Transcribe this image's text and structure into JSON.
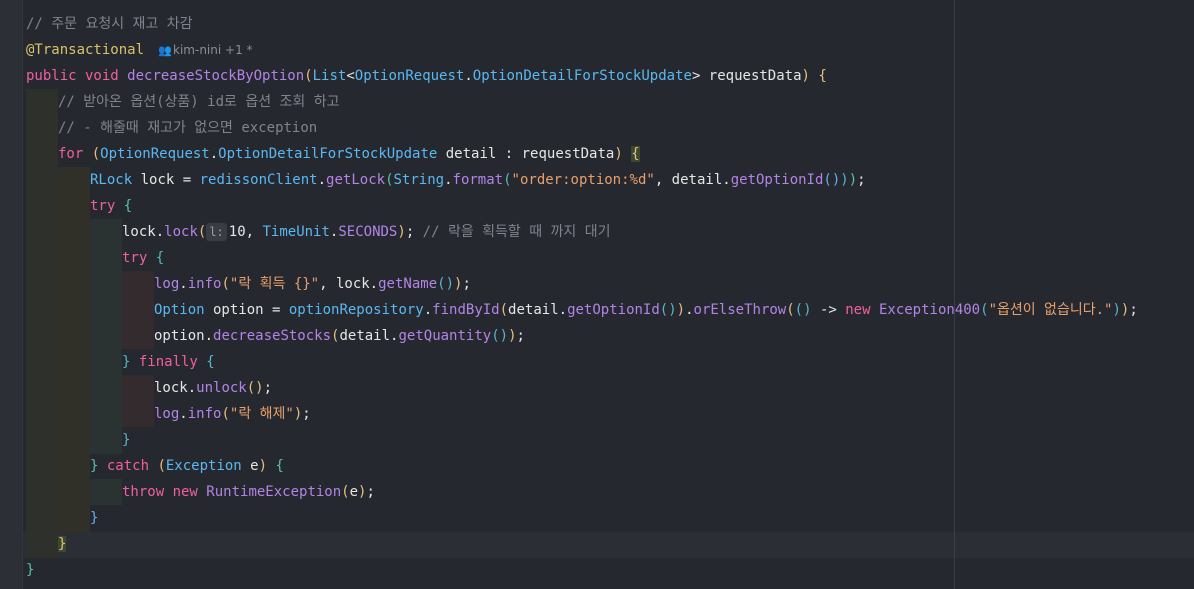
{
  "editor": {
    "lines": [
      [
        [
          "cm",
          "// 주문 요청시 재고 차감"
        ]
      ],
      [
        [
          "ann",
          "@Transactional"
        ]
      ],
      [
        [
          "kw",
          "public void "
        ],
        [
          "fn",
          "decreaseStockByOption"
        ],
        [
          "p-y",
          "("
        ],
        [
          "ty",
          "List"
        ],
        [
          "plain",
          "<"
        ],
        [
          "ty",
          "OptionRequest"
        ],
        [
          "plain",
          "."
        ],
        [
          "ty",
          "OptionDetailForStockUpdate"
        ],
        [
          "plain",
          "> requestData"
        ],
        [
          "p-y",
          ")"
        ],
        [
          "plain",
          " "
        ],
        [
          "p-y",
          "{"
        ]
      ],
      [
        [
          "cm",
          "// 받아온 옵션(상품) id로 옵션 조회 하고"
        ]
      ],
      [
        [
          "cm",
          "// - 해줄때 재고가 없으면 exception"
        ]
      ],
      [
        [
          "kw",
          "for "
        ],
        [
          "p-y",
          "("
        ],
        [
          "ty",
          "OptionRequest"
        ],
        [
          "plain",
          "."
        ],
        [
          "ty",
          "OptionDetailForStockUpdate"
        ],
        [
          "plain",
          " detail : requestData"
        ],
        [
          "p-y",
          ")"
        ],
        [
          "plain",
          " "
        ],
        [
          "br-hl",
          "{"
        ]
      ],
      [
        [
          "ty",
          "RLock"
        ],
        [
          "plain",
          " lock = "
        ],
        [
          "ty",
          "redissonClient"
        ],
        [
          "plain",
          "."
        ],
        [
          "fn",
          "getLock"
        ],
        [
          "p-c",
          "("
        ],
        [
          "ty",
          "String"
        ],
        [
          "plain",
          "."
        ],
        [
          "fn",
          "format"
        ],
        [
          "p-b",
          "("
        ],
        [
          "str",
          "\"order:option:%d\""
        ],
        [
          "plain",
          ", detail."
        ],
        [
          "fn",
          "getOptionId"
        ],
        [
          "p-bl",
          "()"
        ],
        [
          "p-b",
          ")"
        ],
        [
          "p-c",
          ")"
        ],
        [
          "plain",
          ";"
        ]
      ],
      [
        [
          "kw",
          "try "
        ],
        [
          "p-c",
          "{"
        ]
      ],
      [
        [
          "plain",
          "lock."
        ],
        [
          "fn",
          "lock"
        ],
        [
          "p-y",
          "("
        ],
        [
          "hint",
          "l:"
        ],
        [
          "plain",
          "10, "
        ],
        [
          "ty",
          "TimeUnit"
        ],
        [
          "plain",
          "."
        ],
        [
          "fn",
          "SECONDS"
        ],
        [
          "p-y",
          ")"
        ],
        [
          "plain",
          "; "
        ],
        [
          "cm",
          "// 락을 획득할 때 까지 대기"
        ]
      ],
      [
        [
          "kw",
          "try "
        ],
        [
          "p-b",
          "{"
        ]
      ],
      [
        [
          "fn",
          "log"
        ],
        [
          "plain",
          "."
        ],
        [
          "fn",
          "info"
        ],
        [
          "p-y",
          "("
        ],
        [
          "str",
          "\"락 획득 {}\""
        ],
        [
          "plain",
          ", lock."
        ],
        [
          "fn",
          "getName"
        ],
        [
          "p-b",
          "()"
        ],
        [
          "p-y",
          ")"
        ],
        [
          "plain",
          ";"
        ]
      ],
      [
        [
          "ty",
          "Option"
        ],
        [
          "plain",
          " option = "
        ],
        [
          "ty",
          "optionRepository"
        ],
        [
          "plain",
          "."
        ],
        [
          "fn",
          "findById"
        ],
        [
          "p-y",
          "("
        ],
        [
          "plain",
          "detail."
        ],
        [
          "fn",
          "getOptionId"
        ],
        [
          "p-b",
          "()"
        ],
        [
          "p-y",
          ")"
        ],
        [
          "plain",
          "."
        ],
        [
          "fn",
          "orElseThrow"
        ],
        [
          "p-y",
          "("
        ],
        [
          "p-b",
          "()"
        ],
        [
          "plain",
          " -> "
        ],
        [
          "kw",
          "new "
        ],
        [
          "fn",
          "Exception400"
        ],
        [
          "p-b",
          "("
        ],
        [
          "str",
          "\"옵션이 없습니다.\""
        ],
        [
          "p-b",
          ")"
        ],
        [
          "p-y",
          ")"
        ],
        [
          "plain",
          ";"
        ]
      ],
      [
        [
          "plain",
          "option."
        ],
        [
          "fn",
          "decreaseStocks"
        ],
        [
          "p-y",
          "("
        ],
        [
          "plain",
          "detail."
        ],
        [
          "fn",
          "getQuantity"
        ],
        [
          "p-b",
          "()"
        ],
        [
          "p-y",
          ")"
        ],
        [
          "plain",
          ";"
        ]
      ],
      [
        [
          "p-b",
          "} "
        ],
        [
          "kw",
          "finally "
        ],
        [
          "p-b",
          "{"
        ]
      ],
      [
        [
          "plain",
          "lock."
        ],
        [
          "fn",
          "unlock"
        ],
        [
          "p-y",
          "()"
        ],
        [
          "plain",
          ";"
        ]
      ],
      [
        [
          "fn",
          "log"
        ],
        [
          "plain",
          "."
        ],
        [
          "fn",
          "info"
        ],
        [
          "p-y",
          "("
        ],
        [
          "str",
          "\"락 해제\""
        ],
        [
          "p-y",
          ")"
        ],
        [
          "plain",
          ";"
        ]
      ],
      [
        [
          "p-b",
          "}"
        ]
      ],
      [
        [
          "p-c",
          "} "
        ],
        [
          "kw",
          "catch "
        ],
        [
          "p-y",
          "("
        ],
        [
          "ty",
          "Exception"
        ],
        [
          "plain",
          " e"
        ],
        [
          "p-y",
          ")"
        ],
        [
          "plain",
          " "
        ],
        [
          "p-c",
          "{"
        ]
      ],
      [
        [
          "kw",
          "throw new "
        ],
        [
          "fn",
          "RuntimeException"
        ],
        [
          "p-y",
          "("
        ],
        [
          "plain",
          "e"
        ],
        [
          "p-y",
          ")"
        ],
        [
          "plain",
          ";"
        ]
      ],
      [
        [
          "p-bl",
          "}"
        ]
      ],
      [
        [
          "br-hl",
          "}"
        ]
      ],
      [
        [
          "p-c",
          "}"
        ]
      ]
    ],
    "author_hint": "kim-nini +1 *",
    "author_icon": "people-icon"
  }
}
